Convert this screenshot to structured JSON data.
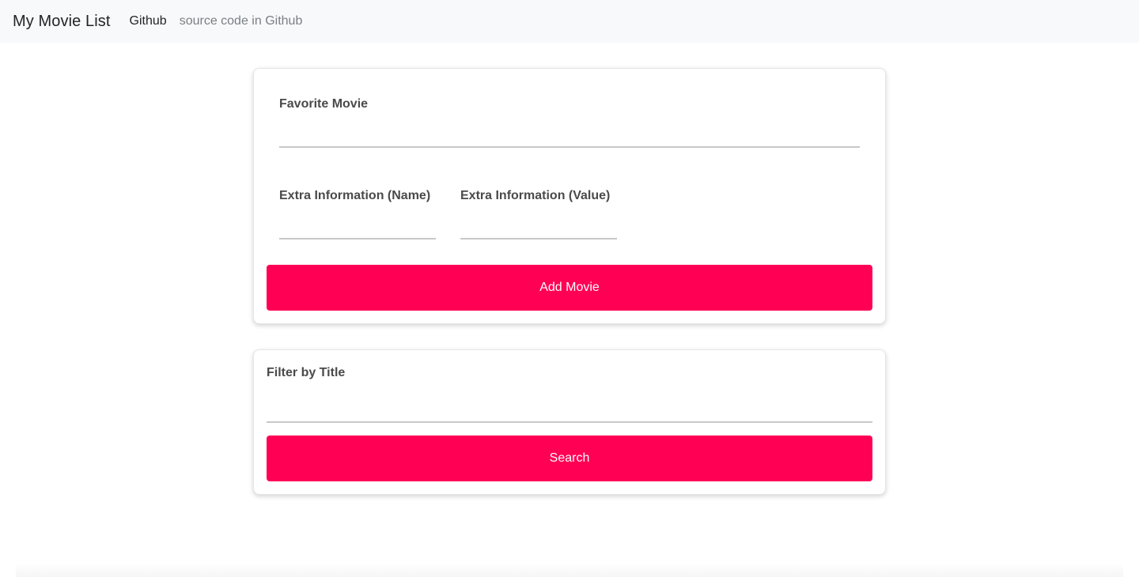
{
  "navbar": {
    "brand": "My Movie List",
    "links": [
      {
        "label": "Github"
      },
      {
        "label": "source code in Github"
      }
    ]
  },
  "add_form": {
    "favorite_movie_label": "Favorite Movie",
    "favorite_movie_value": "",
    "extra_name_label": "Extra Information (Name)",
    "extra_name_value": "",
    "extra_value_label": "Extra Information (Value)",
    "extra_value_value": "",
    "submit_label": "Add Movie"
  },
  "filter_form": {
    "title_label": "Filter by Title",
    "title_value": "",
    "submit_label": "Search"
  },
  "colors": {
    "accent": "#ff0055",
    "navbar_bg": "#f8f9fa",
    "label_text": "#4a4a4a",
    "muted_link": "#7a7f85"
  }
}
